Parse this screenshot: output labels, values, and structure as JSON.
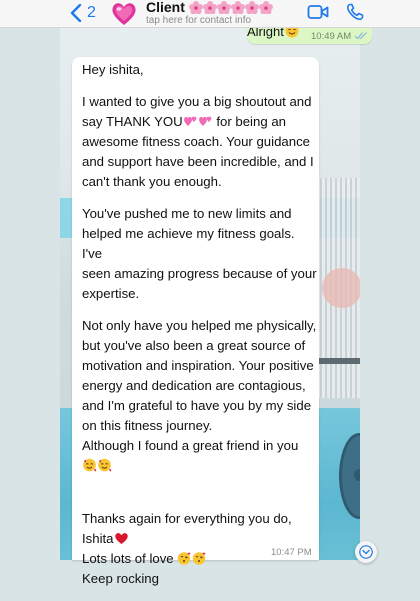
{
  "header": {
    "back_count": "2",
    "contact_name": "Client",
    "contact_subtitle": "tap here for contact info"
  },
  "icons": [
    "chevron-left-icon",
    "avatar-hearts-icon",
    "flower-icon",
    "video-call-icon",
    "phone-icon",
    "smiling-emoji-icon",
    "heart-emoji-icon",
    "kiss-emoji-icon",
    "chevron-down-icon"
  ],
  "colors": {
    "accent": "#1f7aea",
    "outgoing_bubble": "#dcf7c5",
    "incoming_bubble": "#ffffff"
  },
  "chat": {
    "outgoing": {
      "text": "Alright",
      "time": "10:49 AM"
    },
    "incoming": {
      "greeting": "Hey ishita,",
      "p1_a": "I wanted to give you a big shoutout and",
      "p1_b": "say THANK YOU",
      "p1_c": "for being an",
      "p1_d": "awesome fitness coach. Your guidance",
      "p1_e": "and support have been incredible, and I",
      "p1_f": "can't thank you enough.",
      "p2_a": "You've pushed me to new limits and",
      "p2_b": "helped me achieve my fitness goals. I've",
      "p2_c": "seen amazing progress because of your",
      "p2_d": "expertise.",
      "p3_a": "Not only have you helped me physically,",
      "p3_b": "but you've also been a great source of",
      "p3_c": "motivation and inspiration. Your positive",
      "p3_d": "energy and dedication are contagious,",
      "p3_e": "and I'm grateful to have you by my side",
      "p3_f": "on this fitness journey.",
      "p3_g": "Although I found a great friend in you",
      "p4_a": "Thanks again for everything you do,",
      "p4_b": "Ishita",
      "p4_c": "Lots lots of love",
      "p4_d": "Keep rocking",
      "time": "10:47 PM"
    }
  }
}
